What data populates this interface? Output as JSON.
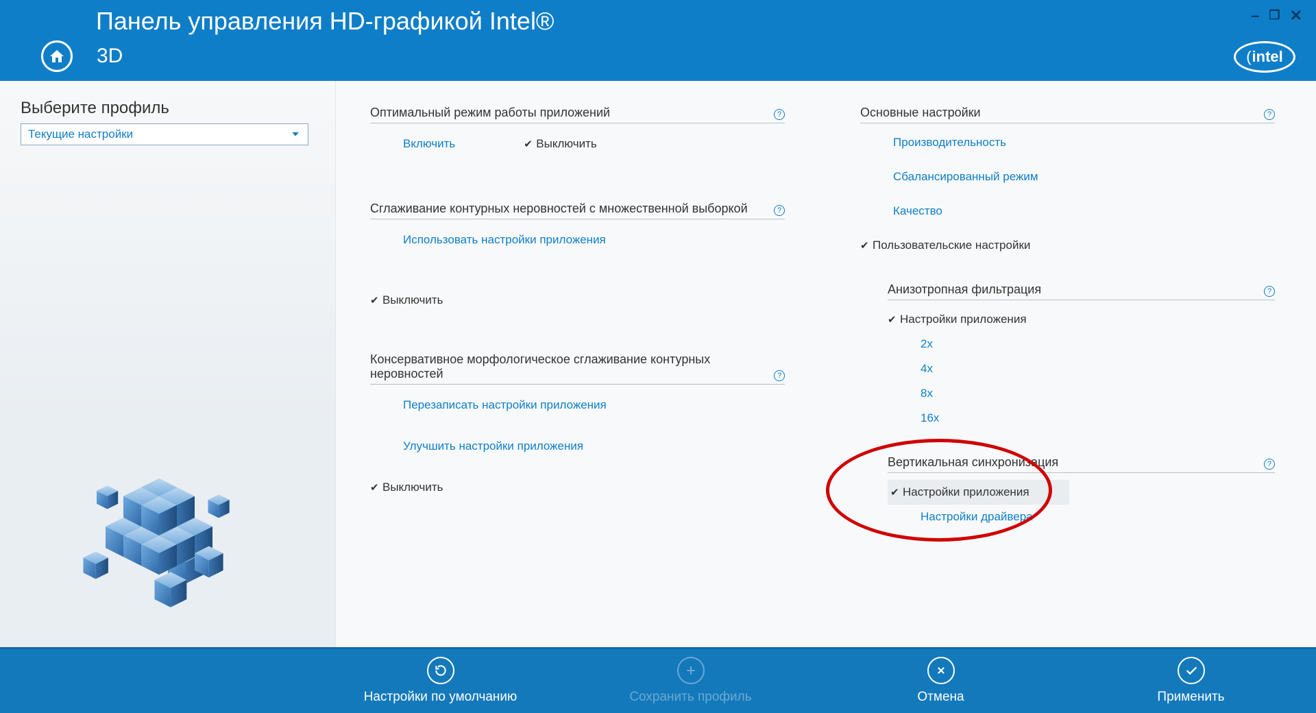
{
  "header": {
    "title": "Панель управления HD-графикой Intel®",
    "section": "3D",
    "logo": "intel"
  },
  "sidebar": {
    "select_profile_label": "Выберите профиль",
    "selected_profile": "Текущие настройки"
  },
  "settings_left": {
    "optimal_mode": {
      "title": "Оптимальный режим работы приложений",
      "enable": "Включить",
      "disable": "Выключить",
      "selected": "disable"
    },
    "msaa": {
      "title": "Сглаживание контурных неровностей с множественной выборкой",
      "use_app": "Использовать настройки приложения",
      "disable": "Выключить",
      "selected": "disable"
    },
    "cmaa": {
      "title": "Консервативное морфологическое сглаживание контурных неровностей",
      "override": "Перезаписать настройки приложения",
      "enhance": "Улучшить настройки приложения",
      "disable": "Выключить",
      "selected": "disable"
    }
  },
  "settings_right": {
    "general": {
      "title": "Основные настройки",
      "performance": "Производительность",
      "balanced": "Сбалансированный режим",
      "quality": "Качество",
      "custom": "Пользовательские настройки",
      "selected": "custom"
    },
    "anisotropic": {
      "title": "Анизотропная фильтрация",
      "app_settings": "Настройки приложения",
      "x2": "2x",
      "x4": "4x",
      "x8": "8x",
      "x16": "16x",
      "selected": "app_settings"
    },
    "vsync": {
      "title": "Вертикальная синхронизация",
      "app_settings": "Настройки приложения",
      "driver_settings": "Настройки драйвера",
      "selected": "app_settings"
    }
  },
  "footer": {
    "defaults": "Настройки по умолчанию",
    "save_profile": "Сохранить профиль",
    "cancel": "Отмена",
    "apply": "Применить"
  }
}
